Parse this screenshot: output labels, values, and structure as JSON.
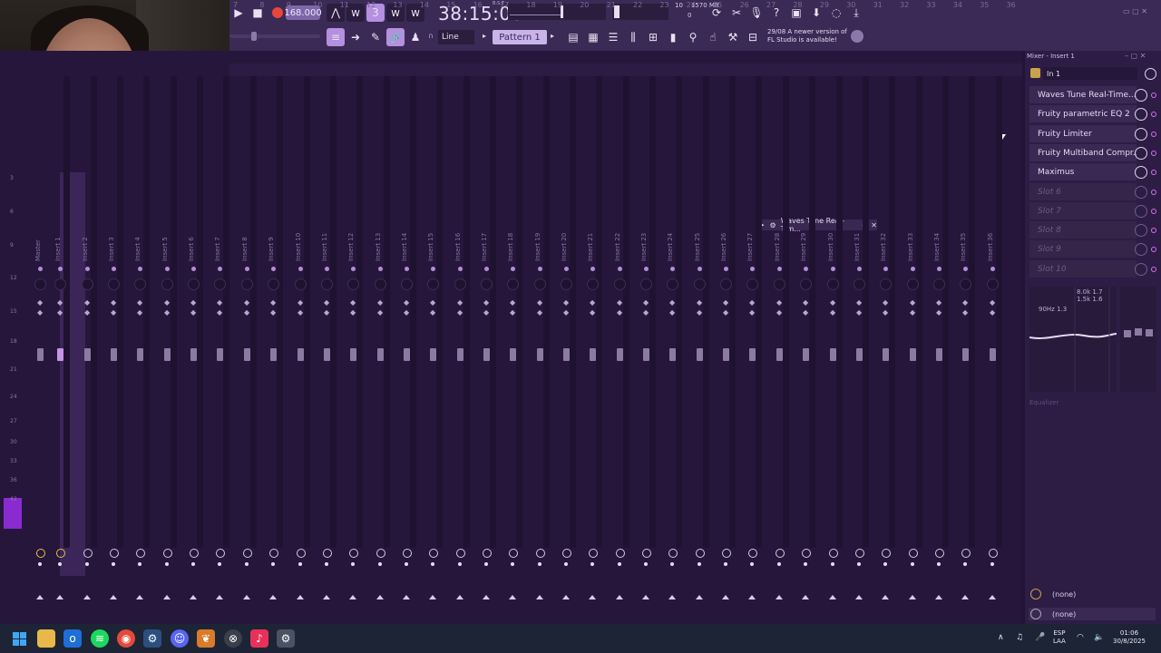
{
  "toolbar": {
    "tempo": "168.000",
    "time": "38:15:00",
    "time_unit": "B:S:T",
    "cpu_top": "10",
    "mem": "1570 MB",
    "cpu_bottom": "0",
    "snap": "Line",
    "pattern": "Pattern 1",
    "news_line1": "29/08  A newer version of",
    "news_line2": "FL Studio is available!",
    "record_color": "#e8463b",
    "accent": "#c9b3e8"
  },
  "ruler": [
    "7",
    "8",
    "9",
    "10",
    "11",
    "12",
    "13",
    "14",
    "15",
    "16",
    "17",
    "18",
    "19",
    "20",
    "21",
    "22",
    "23",
    "24",
    "25",
    "26",
    "27",
    "28",
    "29",
    "30",
    "31",
    "32",
    "33",
    "34",
    "35",
    "36"
  ],
  "db_scale": [
    "3",
    "6",
    "9",
    "12",
    "15",
    "18",
    "21",
    "24",
    "27",
    "30",
    "33",
    "36",
    "42"
  ],
  "tracks": [
    "Master",
    "Insert 1",
    "Insert 2",
    "Insert 3",
    "Insert 4",
    "Insert 5",
    "Insert 6",
    "Insert 7",
    "Insert 8",
    "Insert 9",
    "Insert 10",
    "Insert 11",
    "Insert 12",
    "Insert 13",
    "Insert 14",
    "Insert 15",
    "Insert 16",
    "Insert 17",
    "Insert 18",
    "Insert 19",
    "Insert 20",
    "Insert 21",
    "Insert 22",
    "Insert 23",
    "Insert 24",
    "Insert 25",
    "Insert 26",
    "Insert 27",
    "Insert 28",
    "Insert 29",
    "Insert 30",
    "Insert 31",
    "Insert 32",
    "Insert 33",
    "Insert 34",
    "Insert 35",
    "Insert 36"
  ],
  "popup": {
    "title": "Waves Tune Real-Tim..."
  },
  "mixer_panel": {
    "title": "Mixer - Insert 1",
    "input": "In 1",
    "slots": [
      {
        "label": "Waves Tune Real-Time...",
        "empty": false
      },
      {
        "label": "Fruity parametric EQ 2",
        "empty": false
      },
      {
        "label": "Fruity Limiter",
        "empty": false
      },
      {
        "label": "Fruity Multiband Compr...",
        "empty": false
      },
      {
        "label": "Maximus",
        "empty": false
      },
      {
        "label": "Slot 6",
        "empty": true
      },
      {
        "label": "Slot 7",
        "empty": true
      },
      {
        "label": "Slot 8",
        "empty": true
      },
      {
        "label": "Slot 9",
        "empty": true
      },
      {
        "label": "Slot 10",
        "empty": true
      }
    ],
    "eq_readout_1": "8.0k 1.7",
    "eq_readout_2": "1.5k 1.6",
    "eq_readout_3": "90Hz 1.3",
    "eq_label": "Equalizer",
    "output_1": "(none)",
    "output_2": "(none)"
  },
  "taskbar": {
    "lang1": "ESP",
    "lang2": "LAA",
    "time": "01:06",
    "date": "30/8/2025"
  }
}
